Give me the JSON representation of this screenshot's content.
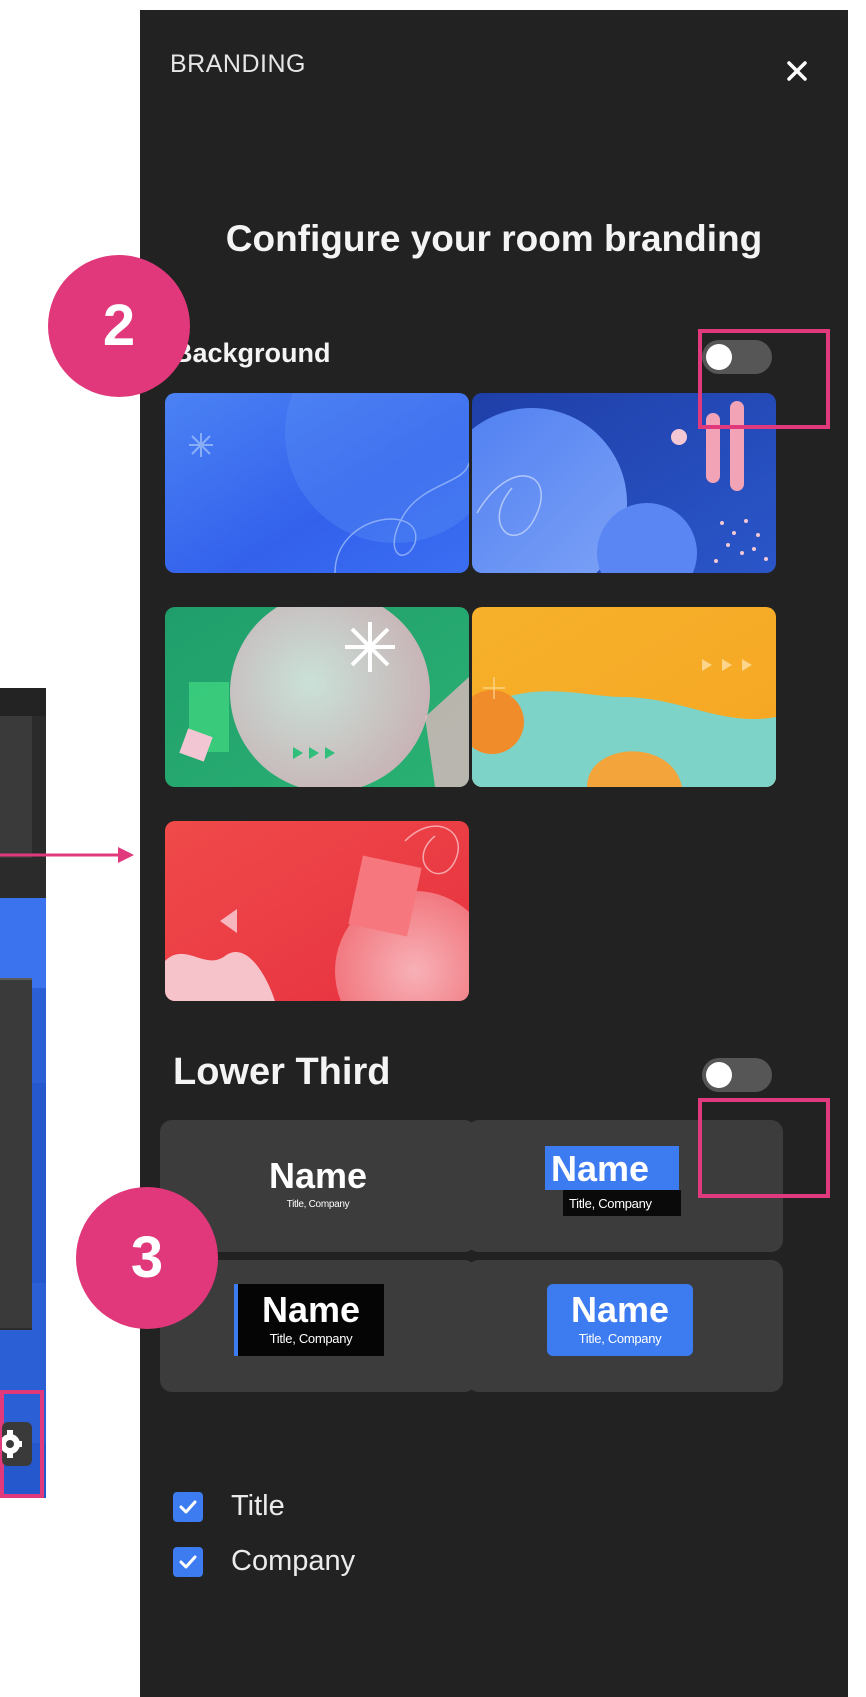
{
  "panel": {
    "header_label": "BRANDING",
    "heading": "Configure your room branding"
  },
  "background_section": {
    "label": "Background",
    "toggle_on": false,
    "thumbnails": [
      {
        "name": "blue-abstract",
        "color": "#3f6ef0"
      },
      {
        "name": "blue-circles",
        "color": "#2c4fc0"
      },
      {
        "name": "green-abstract",
        "color": "#2faa6e"
      },
      {
        "name": "yellow-teal-abstract",
        "color": "#f5b027"
      },
      {
        "name": "red-abstract",
        "color": "#ea3b4a"
      }
    ]
  },
  "lower_third_section": {
    "label": "Lower Third",
    "toggle_on": false,
    "templates": [
      {
        "name": "Name",
        "subtitle": "Title, Company"
      },
      {
        "name": "Name",
        "subtitle": "Title, Company"
      },
      {
        "name": "Name",
        "subtitle": "Title, Company"
      },
      {
        "name": "Name",
        "subtitle": "Title, Company"
      }
    ]
  },
  "options": {
    "title": {
      "label": "Title",
      "checked": true
    },
    "company": {
      "label": "Company",
      "checked": true
    }
  },
  "annotations": {
    "step_2": "2",
    "step_3": "3"
  },
  "colors": {
    "panel_bg": "#222222",
    "accent_blue": "#3d7bf1",
    "annotation_pink": "#e13a7c"
  }
}
